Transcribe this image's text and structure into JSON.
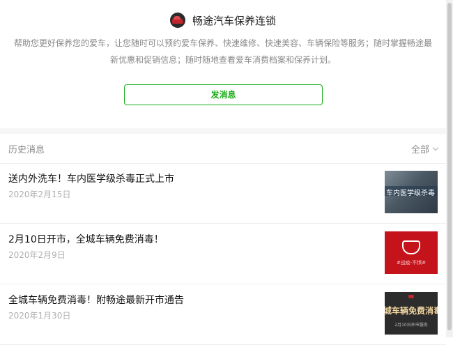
{
  "header": {
    "title": "畅途汽车保养连锁",
    "description": "帮助您更好保养您的爱车，让您随时可以预约爱车保养、快速维修、快速美容、车辆保险等服务；随时掌握畅途最新优惠和促销信息；随时随地查看爱车消费档案和保养计划。",
    "send_button": "发消息"
  },
  "history": {
    "label": "历史消息",
    "filter": "全部"
  },
  "messages": [
    {
      "title": "送内外洗车！车内医学级杀毒正式上市",
      "date": "2020年2月15日",
      "thumb_caption": "车内医学级杀毒"
    },
    {
      "title": "2月10日开市，全城车辆免费消毒！",
      "date": "2020年2月9日",
      "thumb_caption": "#战疫·不惧#"
    },
    {
      "title": "全城车辆免费消毒！附畅途最新开市通告",
      "date": "2020年1月30日",
      "thumb_caption": "城车辆免费消毒",
      "thumb_sub": "2月10日开市服务"
    }
  ],
  "colors": {
    "accent": "#1aad19",
    "muted": "#8a8a8a",
    "date": "#b0b0b0"
  }
}
